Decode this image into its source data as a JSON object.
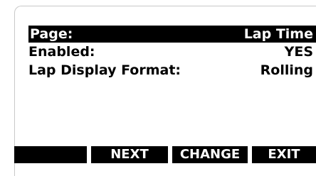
{
  "display": {
    "header": {
      "label": "Page:",
      "value": "Lap Time"
    },
    "rows": [
      {
        "label": "Enabled:",
        "value": "YES"
      },
      {
        "label": "Lap Display Format:",
        "value": "Rolling"
      }
    ]
  },
  "softkeys": [
    {
      "label": ""
    },
    {
      "label": "NEXT"
    },
    {
      "label": "CHANGE"
    },
    {
      "label": "EXIT"
    }
  ]
}
